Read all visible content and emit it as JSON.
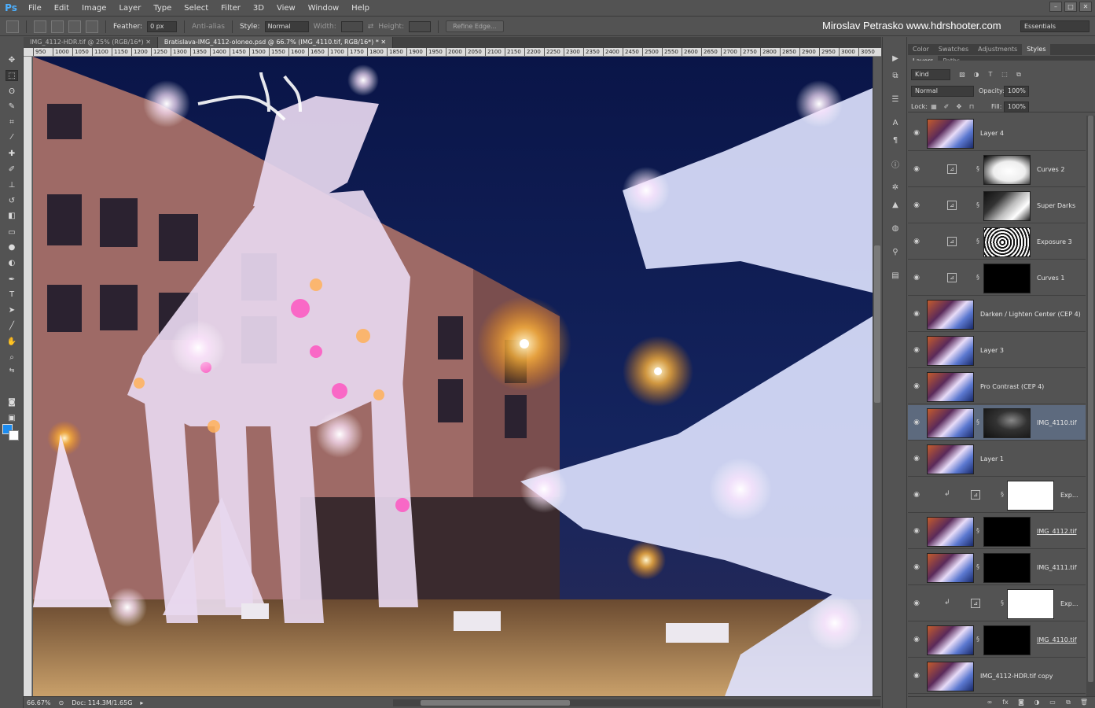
{
  "menubar": {
    "logo": "Ps",
    "items": [
      "File",
      "Edit",
      "Image",
      "Layer",
      "Type",
      "Select",
      "Filter",
      "3D",
      "View",
      "Window",
      "Help"
    ]
  },
  "options": {
    "feather_label": "Feather:",
    "feather_value": "0 px",
    "antialias_label": "Anti-alias",
    "style_label": "Style:",
    "style_value": "Normal",
    "width_label": "Width:",
    "height_label": "Height:",
    "refine_label": "Refine Edge..."
  },
  "watermark": "Miroslav  Petrasko  www.hdrshooter.com",
  "workspace": "Essentials",
  "tabs": [
    {
      "label": "IMG_4112-HDR.tif @ 25% (RGB/16*)"
    },
    {
      "label": "Bratislava-IMG_4112-oloneo.psd @ 66.7% (IMG_4110.tif, RGB/16*) *"
    }
  ],
  "ruler": [
    "950",
    "1000",
    "1050",
    "1100",
    "1150",
    "1200",
    "1250",
    "1300",
    "1350",
    "1400",
    "1450",
    "1500",
    "1550",
    "1600",
    "1650",
    "1700",
    "1750",
    "1800",
    "1850",
    "1900",
    "1950",
    "2000",
    "2050",
    "2100",
    "2150",
    "2200",
    "2250",
    "2300",
    "2350",
    "2400",
    "2450",
    "2500",
    "2550",
    "2600",
    "2650",
    "2700",
    "2750",
    "2800",
    "2850",
    "2900",
    "2950",
    "3000",
    "3050"
  ],
  "status": {
    "zoom": "66.67%",
    "doc": "Doc: 114.3M/1.65G"
  },
  "panel_tabs_top": [
    "Color",
    "Swatches",
    "Adjustments",
    "Styles"
  ],
  "panel_tabs_layers": [
    "Layers",
    "Paths"
  ],
  "layers_ctrl": {
    "kind": "Kind",
    "blend": "Normal",
    "opacity_label": "Opacity:",
    "opacity_value": "100%",
    "lock_label": "Lock:",
    "fill_label": "Fill:",
    "fill_value": "100%"
  },
  "layers": [
    {
      "name": "Layer 4",
      "type": "pixel"
    },
    {
      "name": "Curves 2",
      "type": "adj",
      "mask": "curves2"
    },
    {
      "name": "Super Darks",
      "type": "adj",
      "mask": "superdarks"
    },
    {
      "name": "Exposure 3",
      "type": "adj",
      "mask": "exposure3"
    },
    {
      "name": "Curves 1",
      "type": "adj",
      "mask": "black"
    },
    {
      "name": "Darken / Lighten Center (CEP 4)",
      "type": "pixel"
    },
    {
      "name": "Layer 3",
      "type": "pixel"
    },
    {
      "name": "Pro Contrast (CEP 4)",
      "type": "pixel"
    },
    {
      "name": "IMG_4110.tif",
      "type": "pixelmask",
      "mask": "dark"
    },
    {
      "name": "Layer 1",
      "type": "pixel"
    },
    {
      "name": "Exp...",
      "type": "adjclip",
      "mask": "white"
    },
    {
      "name": "IMG_4112.tif",
      "type": "pixelmask",
      "mask": "black",
      "underline": true
    },
    {
      "name": "IMG_4111.tif",
      "type": "pixelmask",
      "mask": "black"
    },
    {
      "name": "Exp...",
      "type": "adjclip",
      "mask": "white"
    },
    {
      "name": "IMG_4110.tif",
      "type": "pixelmask",
      "mask": "black",
      "underline": true
    },
    {
      "name": "IMG_4112-HDR.tif copy",
      "type": "pixel"
    }
  ]
}
